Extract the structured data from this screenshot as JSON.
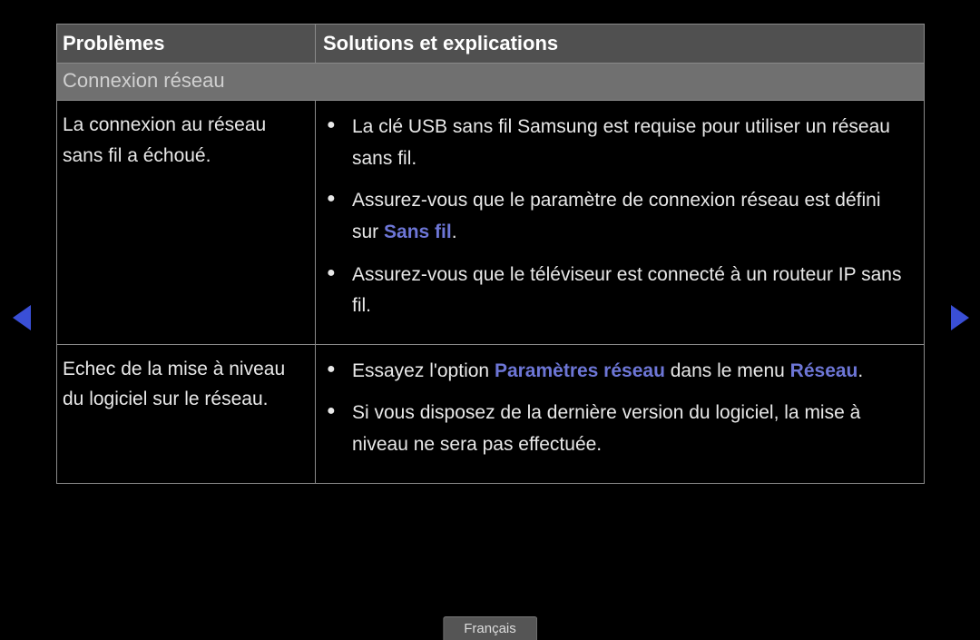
{
  "headers": {
    "problems": "Problèmes",
    "solutions": "Solutions et explications"
  },
  "section": "Connexion réseau",
  "rows": [
    {
      "problem": "La connexion au réseau sans fil a échoué.",
      "solutions": [
        {
          "pre": "La clé USB sans fil Samsung est requise pour utiliser un réseau sans fil."
        },
        {
          "pre": "Assurez-vous que le paramètre de connexion réseau est défini sur ",
          "hl": "Sans fil",
          "post": "."
        },
        {
          "pre": "Assurez-vous que le téléviseur est connecté à un routeur IP sans fil."
        }
      ]
    },
    {
      "problem": "Echec de la mise à niveau du logiciel sur le réseau.",
      "solutions": [
        {
          "pre": "Essayez l'option ",
          "hl": "Paramètres réseau",
          "post": " dans le menu ",
          "hl2": "Réseau",
          "post2": "."
        },
        {
          "pre": "Si vous disposez de la dernière version du logiciel, la mise à niveau ne sera pas effectuée."
        }
      ]
    }
  ],
  "language": "Français"
}
